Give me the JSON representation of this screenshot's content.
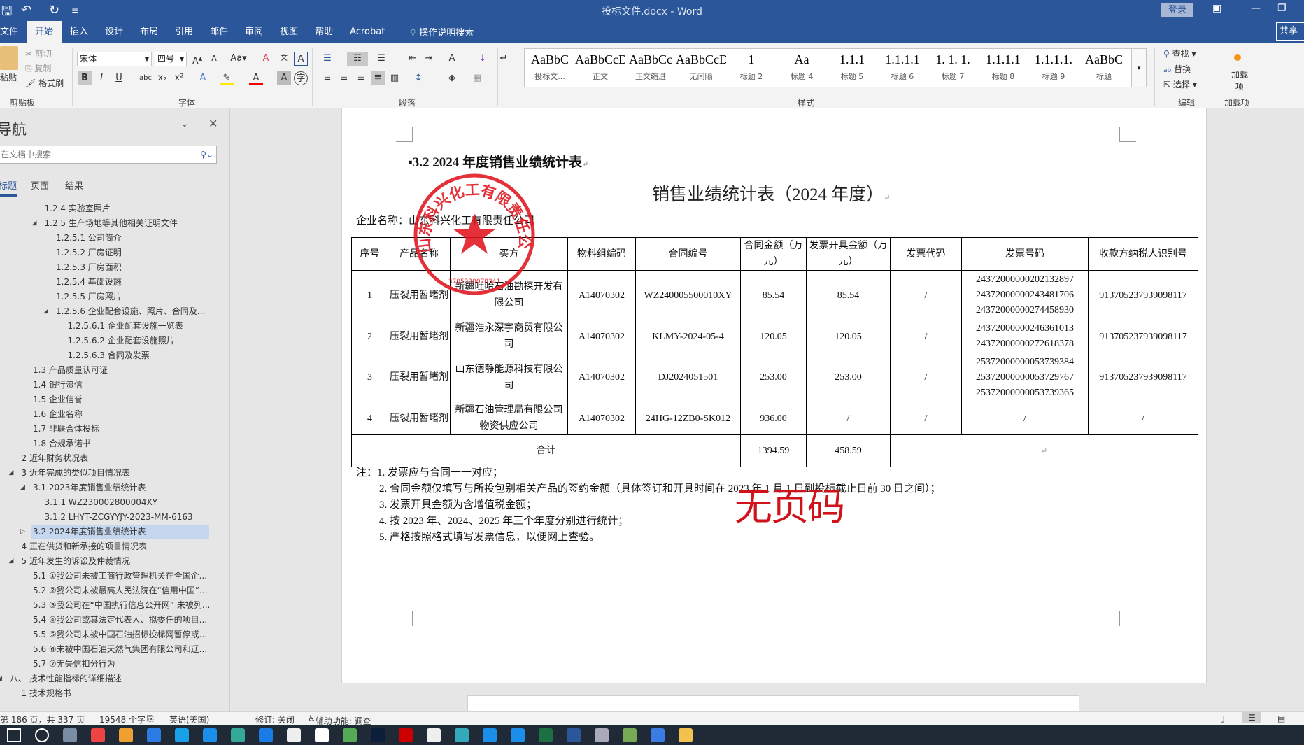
{
  "window": {
    "title": "投标文件.docx  -  Word",
    "login": "登录",
    "share": "共享"
  },
  "tabs": [
    "文件",
    "开始",
    "插入",
    "设计",
    "布局",
    "引用",
    "邮件",
    "审阅",
    "视图",
    "帮助",
    "Acrobat"
  ],
  "tell_me": "操作说明搜索",
  "ribbon": {
    "clipboard": {
      "paste": "粘贴",
      "cut": "剪切",
      "copy": "复制",
      "format_painter": "格式刷",
      "label": "剪贴板"
    },
    "font": {
      "name": "宋体",
      "size": "四号",
      "label": "字体"
    },
    "paragraph": {
      "label": "段落"
    },
    "styles": {
      "label": "样式",
      "items": [
        {
          "preview": "AaBbC",
          "name": "投标文..."
        },
        {
          "preview": "AaBbCcDdI",
          "name": "正文"
        },
        {
          "preview": "AaBbCc",
          "name": "正文缩进"
        },
        {
          "preview": "AaBbCcDdI",
          "name": "无间隔"
        },
        {
          "preview": "1",
          "name": "标题 2"
        },
        {
          "preview": "Aa",
          "name": "标题 4"
        },
        {
          "preview": "1.1.1",
          "name": "标题 5"
        },
        {
          "preview": "1.1.1.1",
          "name": "标题 6"
        },
        {
          "preview": "1. 1. 1.",
          "name": "标题 7"
        },
        {
          "preview": "1.1.1.1",
          "name": "标题 8"
        },
        {
          "preview": "1.1.1.1.",
          "name": "标题 9"
        },
        {
          "preview": "1.1.1.1.",
          "name": "标题 9"
        },
        {
          "preview": "AaBbC",
          "name": "标题"
        }
      ]
    },
    "editing": {
      "find": "查找",
      "replace": "替换",
      "select": "选择",
      "label": "编辑"
    },
    "addins": {
      "button": "加载项",
      "label": "加载项"
    }
  },
  "nav": {
    "title": "导航",
    "search_placeholder": "在文档中搜索",
    "tabs": [
      "标题",
      "页面",
      "结果"
    ],
    "items": [
      {
        "level": 3,
        "text": "1.2.4 实验室照片",
        "toggle": ""
      },
      {
        "level": 3,
        "text": "1.2.5 生产场地等其他相关证明文件",
        "toggle": "expanded"
      },
      {
        "level": 4,
        "text": "1.2.5.1 公司简介",
        "toggle": ""
      },
      {
        "level": 4,
        "text": "1.2.5.2 厂房证明",
        "toggle": ""
      },
      {
        "level": 4,
        "text": "1.2.5.3 厂房面积",
        "toggle": ""
      },
      {
        "level": 4,
        "text": "1.2.5.4 基础设施",
        "toggle": ""
      },
      {
        "level": 4,
        "text": "1.2.5.5 厂房照片",
        "toggle": ""
      },
      {
        "level": 4,
        "text": "1.2.5.6 企业配套设施、照片、合同及...",
        "toggle": "expanded"
      },
      {
        "level": 5,
        "text": "1.2.5.6.1 企业配套设施一览表",
        "toggle": ""
      },
      {
        "level": 5,
        "text": "1.2.5.6.2 企业配套设施照片",
        "toggle": ""
      },
      {
        "level": 5,
        "text": "1.2.5.6.3 合同及发票",
        "toggle": ""
      },
      {
        "level": 2,
        "text": "1.3 产品质量认可证",
        "toggle": ""
      },
      {
        "level": 2,
        "text": "1.4 银行资信",
        "toggle": ""
      },
      {
        "level": 2,
        "text": "1.5 企业信誉",
        "toggle": ""
      },
      {
        "level": 2,
        "text": "1.6 企业名称",
        "toggle": ""
      },
      {
        "level": 2,
        "text": "1.7 非联合体投标",
        "toggle": ""
      },
      {
        "level": 2,
        "text": "1.8 合规承诺书",
        "toggle": ""
      },
      {
        "level": 1,
        "text": "2 近年财务状况表",
        "toggle": ""
      },
      {
        "level": 1,
        "text": "3 近年完成的类似项目情况表",
        "toggle": "expanded"
      },
      {
        "level": 2,
        "text": "3.1 2023年度销售业绩统计表",
        "toggle": "expanded"
      },
      {
        "level": 3,
        "text": "3.1.1 WZ230002800004XY",
        "toggle": ""
      },
      {
        "level": 3,
        "text": "3.1.2 LHYT-ZCGYYJY-2023-MM-6163",
        "toggle": ""
      },
      {
        "level": 2,
        "text": "3.2 2024年度销售业绩统计表",
        "toggle": "collapsed",
        "selected": true
      },
      {
        "level": 1,
        "text": "4 正在供货和新承接的项目情况表",
        "toggle": ""
      },
      {
        "level": 1,
        "text": "5 近年发生的诉讼及仲裁情况",
        "toggle": "expanded"
      },
      {
        "level": 2,
        "text": "5.1 ①我公司未被工商行政管理机关在全国企...",
        "toggle": ""
      },
      {
        "level": 2,
        "text": "5.2 ②我公司未被最高人民法院在“信用中国”...",
        "toggle": ""
      },
      {
        "level": 2,
        "text": "5.3 ③我公司在“中国执行信息公开网” 未被列...",
        "toggle": ""
      },
      {
        "level": 2,
        "text": "5.4 ④我公司或其法定代表人、拟委任的项目...",
        "toggle": ""
      },
      {
        "level": 2,
        "text": "5.5 ⑤我公司未被中国石油招标投标网暂停或...",
        "toggle": ""
      },
      {
        "level": 2,
        "text": "5.6 ⑥未被中国石油天然气集团有限公司和辽...",
        "toggle": ""
      },
      {
        "level": 2,
        "text": "5.7 ⑦无失信扣分行为",
        "toggle": ""
      },
      {
        "level": 0,
        "text": "八、 技术性能指标的详细描述",
        "toggle": "expanded"
      },
      {
        "level": 1,
        "text": "1 技术规格书",
        "toggle": ""
      }
    ]
  },
  "document": {
    "heading": "3.2    2024 年度销售业绩统计表",
    "table_title": "销售业绩统计表（2024 年度）",
    "company": "企业名称：山东科兴化工有限责任公司",
    "headers": [
      "序号",
      "产品名称",
      "买方",
      "物料组编码",
      "合同编号",
      "合同金额（万元）",
      "发票开具金额（万元）",
      "发票代码",
      "发票号码",
      "收款方纳税人识别号"
    ],
    "rows": [
      [
        "1",
        "压裂用暂堵剂",
        "新疆吐哈石油勘探开发有限公司",
        "A14070302",
        "WZ240005500010XY",
        "85.54",
        "85.54",
        "/",
        "24372000000202132897\n24372000000243481706\n24372000000274458930",
        "913705237939098117"
      ],
      [
        "2",
        "压裂用暂堵剂",
        "新疆浩永深宇商贸有限公司",
        "A14070302",
        "KLMY-2024-05-4",
        "120.05",
        "120.05",
        "/",
        "24372000000246361013\n24372000000272618378",
        "913705237939098117"
      ],
      [
        "3",
        "压裂用暂堵剂",
        "山东德静能源科技有限公司",
        "A14070302",
        "DJ2024051501",
        "253.00",
        "253.00",
        "/",
        "25372000000053739384\n25372000000053729767\n25372000000053739365",
        "913705237939098117"
      ],
      [
        "4",
        "压裂用暂堵剂",
        "新疆石油管理局有限公司物资供应公司",
        "A14070302",
        "24HG-12ZB0-SK012",
        "936.00",
        "/",
        "/",
        "/",
        "/"
      ]
    ],
    "total": {
      "label": "合计",
      "contract": "1394.59",
      "invoice": "458.59"
    },
    "notes": [
      "注：1. 发票应与合同一一对应；",
      "2. 合同金额仅填写与所投包别相关产品的签约金额（具体签订和开具时间在 2023 年 1 月 1 日到投标截止日前 30 日之间）；",
      "3. 发票开具金额为含增值税金额；",
      "4. 按 2023 年、2024、2025 年三个年度分别进行统计；",
      "5. 严格按照格式填写发票信息，以便网上查验。"
    ],
    "stamp_text": "山东科兴化工有限责任公司",
    "stamp_number": "3705230078341",
    "watermark": "无页码"
  },
  "status": {
    "page": "第 186 页，共 337 页",
    "words": "19548 个字",
    "language": "英语(美国)",
    "track": "修订: 关闭",
    "accessibility": "辅助功能: 调查"
  },
  "taskbar": {
    "icons": [
      "start",
      "search",
      "calculator",
      "chrome",
      "camera",
      "app",
      "app2",
      "app3",
      "app4",
      "app5",
      "app6",
      "app7",
      "app8",
      "photoshop",
      "acrobat",
      "qq",
      "app9",
      "app10",
      "app11",
      "excel",
      "word",
      "app12",
      "app13",
      "app14",
      "explorer"
    ]
  },
  "colors": {
    "brand": "#2b579a",
    "stamp": "#e0141e",
    "watermark": "#d0121b"
  }
}
